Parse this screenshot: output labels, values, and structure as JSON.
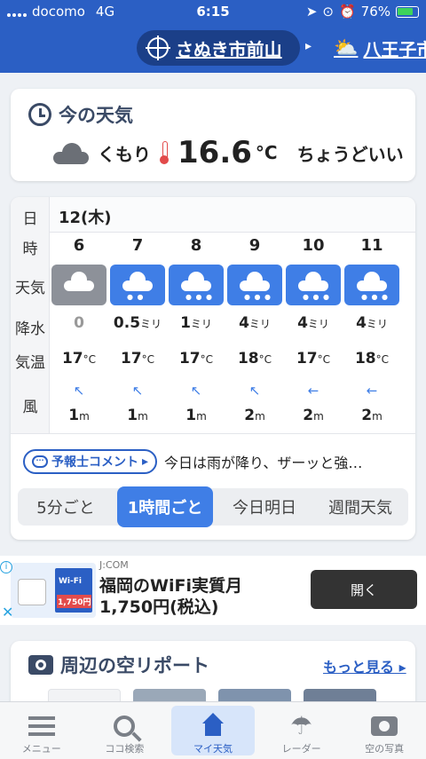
{
  "status": {
    "carrier": "docomo",
    "network": "4G",
    "time": "6:15",
    "battery": "76%"
  },
  "header": {
    "location": "さぬき市前山",
    "next_location": "八王子市"
  },
  "now": {
    "title": "今の天気",
    "condition": "くもり",
    "temperature": "16.6",
    "unit": "°C",
    "feel": "ちょうどいい"
  },
  "forecast": {
    "row_labels": {
      "day": "日",
      "hour": "時",
      "weather": "天気",
      "precip": "降水",
      "temp": "気温",
      "wind": "風"
    },
    "day": "12(木)",
    "hours": [
      {
        "hour": "6",
        "icon": "cloudy-icon",
        "precip": "0",
        "precip_unit": "",
        "temp": "17",
        "wind": "1",
        "wind_dir": "↖"
      },
      {
        "hour": "7",
        "icon": "rain-icon",
        "precip": "0.5",
        "precip_unit": "ミリ",
        "temp": "17",
        "wind": "1",
        "wind_dir": "↖"
      },
      {
        "hour": "8",
        "icon": "heavy-rain-icon",
        "precip": "1",
        "precip_unit": "ミリ",
        "temp": "17",
        "wind": "1",
        "wind_dir": "↖"
      },
      {
        "hour": "9",
        "icon": "heavy-rain-icon",
        "precip": "4",
        "precip_unit": "ミリ",
        "temp": "18",
        "wind": "2",
        "wind_dir": "↖"
      },
      {
        "hour": "10",
        "icon": "heavy-rain-icon",
        "precip": "4",
        "precip_unit": "ミリ",
        "temp": "17",
        "wind": "2",
        "wind_dir": "←"
      },
      {
        "hour": "11",
        "icon": "heavy-rain-icon",
        "precip": "4",
        "precip_unit": "ミリ",
        "temp": "18",
        "wind": "2",
        "wind_dir": "←"
      }
    ],
    "temp_unit": "°C",
    "wind_unit": "m",
    "comment_button": "予報士コメント",
    "comment_text": "今日は雨が降り、ザーッと強…",
    "segments": [
      "5分ごと",
      "1時間ごと",
      "今日明日",
      "週間天気"
    ],
    "active_segment": "1時間ごと"
  },
  "ad": {
    "brand": "J:COM",
    "headline_line1": "福岡のWiFi実質月",
    "headline_line2": "1,750円(税込)",
    "open_label": "開く",
    "thumb_label": "Wi-Fi",
    "thumb_price": "1,750円"
  },
  "sky": {
    "title": "周辺の空リポート",
    "more": "もっと見る"
  },
  "tabs": [
    {
      "label": "メニュー",
      "icon": "menu-icon"
    },
    {
      "label": "ココ検索",
      "icon": "search-icon"
    },
    {
      "label": "マイ天気",
      "icon": "home-icon"
    },
    {
      "label": "レーダー",
      "icon": "radar-icon"
    },
    {
      "label": "空の写真",
      "icon": "camera-icon"
    }
  ],
  "colors": {
    "brand": "#2b5fc4",
    "rain_tile": "#3f7ee6",
    "cloudy_tile": "#8d9199"
  }
}
